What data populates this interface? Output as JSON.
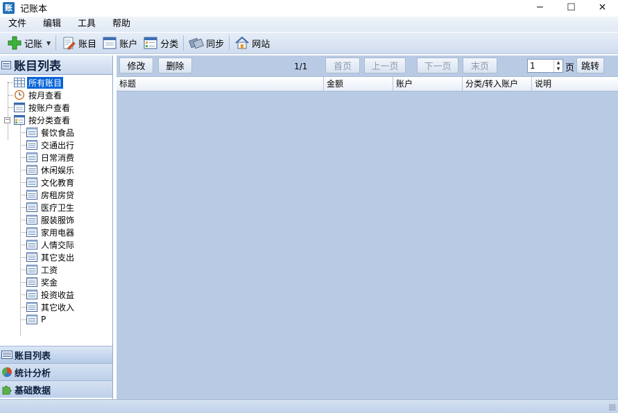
{
  "window": {
    "icon_text": "账",
    "title": "记账本",
    "minimize": "─",
    "maximize": "☐",
    "close": "✕"
  },
  "menu": [
    "文件",
    "编辑",
    "工具",
    "帮助"
  ],
  "toolbar": {
    "record": "记账",
    "subject": "账目",
    "account": "账户",
    "category": "分类",
    "sync": "同步",
    "website": "网站"
  },
  "left_panel": {
    "title": "账目列表",
    "tree": {
      "all": "所有账目",
      "by_month": "按月查看",
      "by_account": "按账户查看",
      "by_category": "按分类查看",
      "categories": [
        "餐饮食品",
        "交通出行",
        "日常消费",
        "休闲娱乐",
        "文化教育",
        "房租房贷",
        "医疗卫生",
        "服装服饰",
        "家用电器",
        "人情交际",
        "其它支出",
        "工资",
        "奖金",
        "投资收益",
        "其它收入",
        "P"
      ]
    },
    "nav": {
      "list": "账目列表",
      "stats": "统计分析",
      "base": "基础数据"
    }
  },
  "right_panel": {
    "edit": "修改",
    "delete": "删除",
    "page_info": "1/1",
    "first": "首页",
    "prev": "上一页",
    "next": "下一页",
    "last": "末页",
    "page_value": "1",
    "page_unit": "页",
    "jump": "跳转",
    "columns": [
      "标题",
      "金额",
      "账户",
      "分类/转入账户",
      "说明"
    ]
  },
  "colors": {
    "accent": "#0a64d8",
    "panel_bg": "#b9cbe4"
  }
}
